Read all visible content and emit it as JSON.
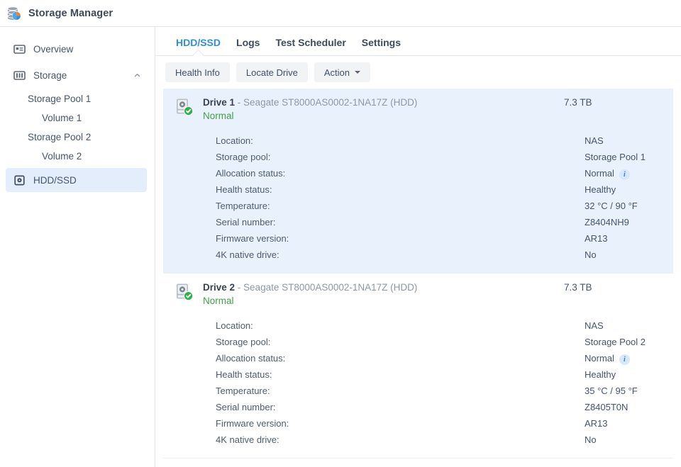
{
  "window": {
    "title": "Storage Manager",
    "icon": "storage-manager-icon"
  },
  "sidebar": {
    "items": [
      {
        "label": "Overview",
        "icon": "overview-icon",
        "level": 0,
        "selected": false
      },
      {
        "label": "Storage",
        "icon": "storage-icon",
        "level": 0,
        "selected": false,
        "chevron": "chevron-up-icon"
      },
      {
        "label": "Storage Pool 1",
        "level": 1,
        "selected": false
      },
      {
        "label": "Volume 1",
        "level": 2,
        "selected": false
      },
      {
        "label": "Storage Pool 2",
        "level": 1,
        "selected": false
      },
      {
        "label": "Volume 2",
        "level": 2,
        "selected": false
      },
      {
        "label": "HDD/SSD",
        "icon": "hdd-icon",
        "level": 0,
        "selected": true
      }
    ]
  },
  "tabs": [
    {
      "label": "HDD/SSD",
      "active": true
    },
    {
      "label": "Logs",
      "active": false
    },
    {
      "label": "Test Scheduler",
      "active": false
    },
    {
      "label": "Settings",
      "active": false
    }
  ],
  "toolbar": {
    "health_info_label": "Health Info",
    "locate_drive_label": "Locate Drive",
    "action_label": "Action"
  },
  "labels": {
    "location": "Location:",
    "storage_pool": "Storage pool:",
    "allocation_status": "Allocation status:",
    "health_status": "Health status:",
    "temperature": "Temperature:",
    "serial_number": "Serial number:",
    "firmware_version": "Firmware version:",
    "native_4k": "4K native drive:"
  },
  "drives": [
    {
      "name": "Drive 1",
      "model": "- Seagate ST8000AS0002-1NA17Z (HDD)",
      "status": "Normal",
      "capacity": "7.3 TB",
      "selected": true,
      "details": {
        "location": "NAS",
        "storage_pool": "Storage Pool 1",
        "allocation_status": "Normal",
        "health_status": "Healthy",
        "temperature": "32 °C / 90 °F",
        "serial_number": "Z8404NH9",
        "firmware_version": "AR13",
        "native_4k": "No"
      }
    },
    {
      "name": "Drive 2",
      "model": "- Seagate ST8000AS0002-1NA17Z (HDD)",
      "status": "Normal",
      "capacity": "7.3 TB",
      "selected": false,
      "details": {
        "location": "NAS",
        "storage_pool": "Storage Pool 2",
        "allocation_status": "Normal",
        "health_status": "Healthy",
        "temperature": "35 °C / 95 °F",
        "serial_number": "Z8405T0N",
        "firmware_version": "AR13",
        "native_4k": "No"
      }
    }
  ],
  "colors": {
    "accent": "#2f8de4",
    "ok_green": "#43a047",
    "selected_row": "#e9f1fd",
    "selected_nav": "#e4edfb"
  }
}
